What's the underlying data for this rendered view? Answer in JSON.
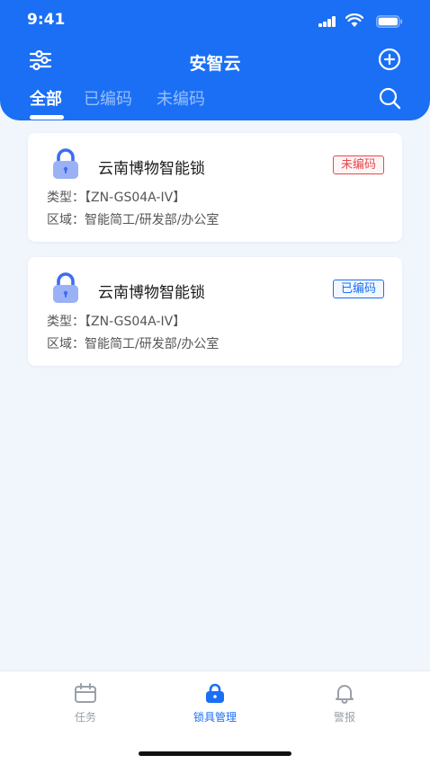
{
  "status_bar": {
    "time": "9:41"
  },
  "header": {
    "title": "安智云",
    "icons": {
      "left": "filter-sliders-icon",
      "right": "add-circle-icon",
      "search": "search-icon"
    }
  },
  "tabs": [
    {
      "label": "全部",
      "active": true
    },
    {
      "label": "已编码",
      "active": false
    },
    {
      "label": "未编码",
      "active": false
    }
  ],
  "devices": [
    {
      "name": "云南博物智能锁",
      "status": "未编码",
      "status_color": "#e5484d",
      "type_line": "类型：【ZN-GS04A-IV】",
      "area_line": "区域：智能简工/研发部/办公室"
    },
    {
      "name": "云南博物智能锁",
      "status": "已编码",
      "status_color": "#1a6ff5",
      "type_line": "类型：【ZN-GS04A-IV】",
      "area_line": "区域：智能简工/研发部/办公室"
    }
  ],
  "tabbar": [
    {
      "label": "任务",
      "icon": "calendar-icon",
      "active": false
    },
    {
      "label": "锁具管理",
      "icon": "lock-icon",
      "active": true
    },
    {
      "label": "警报",
      "icon": "bell-icon",
      "active": false
    }
  ],
  "colors": {
    "primary": "#1a6ff5",
    "background": "#f1f5fc",
    "danger": "#e5484d"
  }
}
